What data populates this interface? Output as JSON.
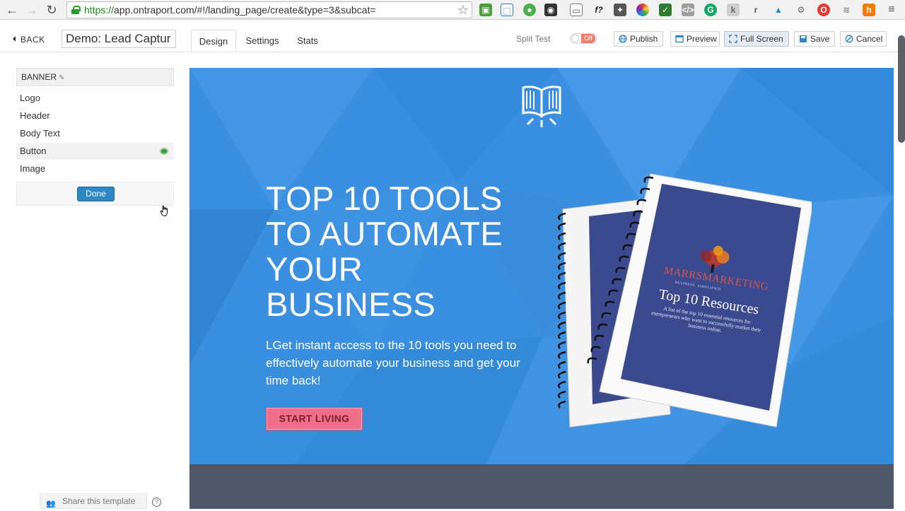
{
  "browser": {
    "url_scheme": "https://",
    "url_rest": "app.ontraport.com/#!/landing_page/create&type=3&subcat="
  },
  "toolbar": {
    "back_label": "BACK",
    "page_title_value": "Demo: Lead Captur",
    "tabs": [
      {
        "label": "Design",
        "active": true
      },
      {
        "label": "Settings",
        "active": false
      },
      {
        "label": "Stats",
        "active": false
      }
    ],
    "split_test_label": "Split Test",
    "split_test_state": "Off",
    "publish_label": "Publish",
    "preview_label": "Preview",
    "fullscreen_label": "Full Screen",
    "save_label": "Save",
    "cancel_label": "Cancel"
  },
  "sidebar": {
    "section_title": "BANNER",
    "items": [
      {
        "label": "Logo"
      },
      {
        "label": "Header"
      },
      {
        "label": "Body Text"
      },
      {
        "label": "Button"
      },
      {
        "label": "Image"
      }
    ],
    "done_label": "Done",
    "share_label": "Share this template"
  },
  "banner": {
    "headline": "TOP 10 TOOLS TO AUTOMATE YOUR BUSINESS",
    "body": "LGet instant access to the 10 tools you need to effectively automate your business and get your time back!",
    "button_label": "START LIVING",
    "ebook_brand": "MARRSMARKETING",
    "ebook_tagline": "BUSINESS. SIMPLIFIED.",
    "ebook_title": "Top 10 Resources",
    "ebook_subtitle": "A list of the top 10 essential resources for entrepreneurs who want to successfully market their business online.",
    "background_color": "#3a8fe0",
    "button_color": "#f06f88"
  },
  "colors": {
    "accent": "#2d86c6",
    "toggle_off": "#ef7c6e"
  }
}
